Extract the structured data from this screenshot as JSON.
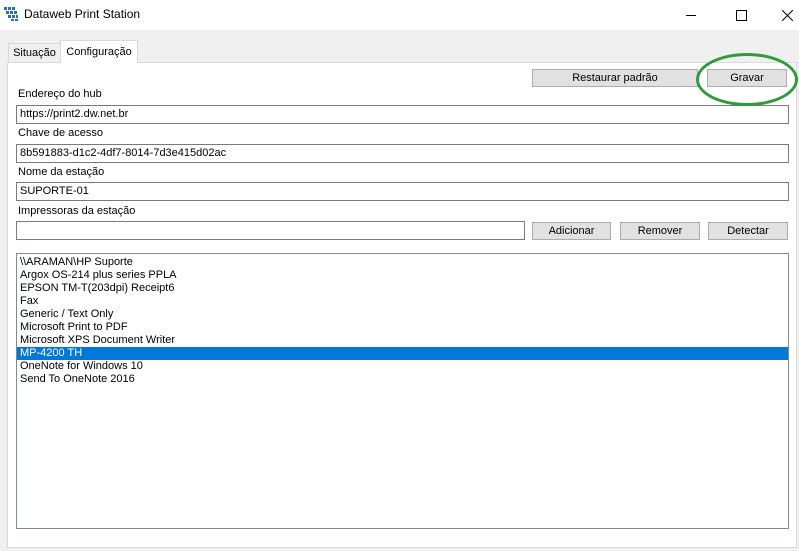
{
  "window": {
    "title": "Dataweb Print Station",
    "controls": {
      "minimize": "—",
      "maximize": "☐",
      "close": "✕"
    }
  },
  "tabs": [
    {
      "label": "Situação",
      "active": false
    },
    {
      "label": "Configuração",
      "active": true
    }
  ],
  "config": {
    "restore_button": "Restaurar padrão",
    "save_button": "Gravar",
    "hub_label": "Endereço do hub",
    "hub_value": "https://print2.dw.net.br",
    "key_label": "Chave de acesso",
    "key_value": "8b591883-d1c2-4df7-8014-7d3e415d02ac",
    "station_label": "Nome da estação",
    "station_value": "SUPORTE-01",
    "printers_label": "Impressoras da estação",
    "printer_input_value": "",
    "add_button": "Adicionar",
    "remove_button": "Remover",
    "detect_button": "Detectar",
    "printers": [
      "\\\\ARAMAN\\HP Suporte",
      "Argox OS-214 plus series PPLA",
      "EPSON TM-T(203dpi) Receipt6",
      "Fax",
      "Generic / Text Only",
      "Microsoft Print to PDF",
      "Microsoft XPS Document Writer",
      "MP-4200 TH",
      "OneNote for Windows 10",
      "Send To OneNote 2016"
    ],
    "selected_printer": "MP-4200 TH"
  },
  "colors": {
    "selection": "#0078d7",
    "annotation": "#2e9c3a"
  }
}
